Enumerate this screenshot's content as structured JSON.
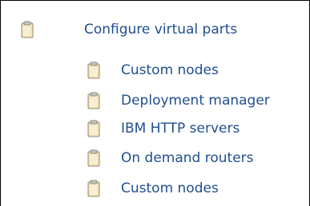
{
  "tree": {
    "root": {
      "label": "Configure virtual parts",
      "icon": "clipboard-icon"
    },
    "children": [
      {
        "label": "Custom nodes",
        "icon": "clipboard-icon"
      },
      {
        "label": "Deployment manager",
        "icon": "clipboard-icon"
      },
      {
        "label": "IBM HTTP servers",
        "icon": "clipboard-icon"
      },
      {
        "label": "On demand routers",
        "icon": "clipboard-icon"
      },
      {
        "label": "Custom nodes",
        "icon": "clipboard-icon"
      }
    ]
  },
  "colors": {
    "text": "#1f4f8f",
    "icon_body": "#f1e1b2",
    "icon_border": "#9a8a72",
    "icon_clip": "#c9c2b8"
  }
}
